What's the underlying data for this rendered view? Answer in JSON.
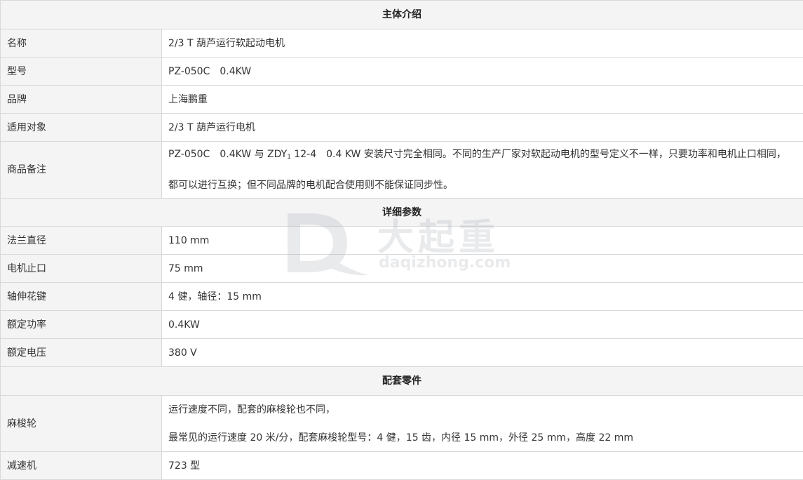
{
  "sections": {
    "intro": "主体介绍",
    "params": "详细参数",
    "parts": "配套零件"
  },
  "rows": {
    "name": {
      "label": "名称",
      "value": "2/3 T 葫芦运行软起动电机"
    },
    "model": {
      "label": "型号",
      "value": "PZ-050C　0.4KW"
    },
    "brand": {
      "label": "品牌",
      "value": "上海鹏重"
    },
    "target": {
      "label": "适用对象",
      "value": "2/3 T 葫芦运行电机"
    },
    "remarks": {
      "label": "商品备注",
      "line1_a": "PZ-050C　0.4KW  与 ZDY",
      "line1_sub": "1",
      "line1_b": " 12-4　0.4 KW 安装尺寸完全相同。不同的生产厂家对软起动电机的型号定义不一样，只要功率和电机止口相同，",
      "line2": "都可以进行互换；但不同品牌的电机配合使用则不能保证同步性。"
    },
    "flange": {
      "label": "法兰直径",
      "value": "110 mm"
    },
    "spigot": {
      "label": "电机止口",
      "value": "75 mm"
    },
    "spline": {
      "label": "轴伸花键",
      "value": "4 健，轴径：15 mm"
    },
    "power": {
      "label": "额定功率",
      "value": "0.4KW"
    },
    "voltage": {
      "label": "额定电压",
      "value": "380 V"
    },
    "gear": {
      "label": "麻梭轮",
      "line1": "运行速度不同，配套的麻梭轮也不同，",
      "line2": "最常见的运行速度 20 米/分，配套麻梭轮型号：4 健，15 齿，内径 15 mm，外径 25 mm，高度 22 mm"
    },
    "reducer": {
      "label": "减速机",
      "value": "723 型"
    }
  },
  "watermark": {
    "cn": "大起重",
    "en": "daqizhong.com"
  }
}
